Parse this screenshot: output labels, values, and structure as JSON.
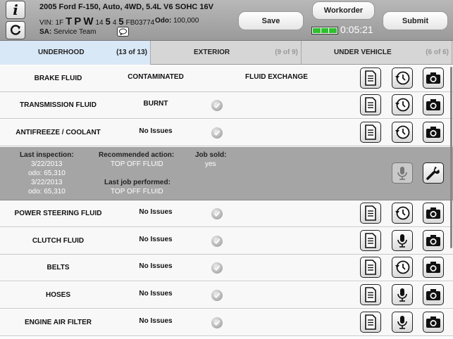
{
  "header": {
    "vehicle_title": "2005 Ford F-150, Auto, 4WD, 5.4L V6 SOHC 16V",
    "vin_label": "VIN:",
    "vin_parts": [
      "1F",
      "T",
      "P",
      "W",
      "14",
      "5",
      "4",
      "5",
      "FB03774"
    ],
    "odo_label": "Odo:",
    "odo_value": "100,000",
    "sa_label": "SA:",
    "sa_value": "Service Team",
    "save_label": "Save",
    "workorder_label": "Workorder",
    "submit_label": "Submit",
    "timer": "0:05:21",
    "progress_segments_filled": 3
  },
  "tabs": [
    {
      "label": "UNDERHOOD",
      "count": "(13 of 13)",
      "active": true
    },
    {
      "label": "EXTERIOR",
      "count": "(9 of 9)",
      "active": false
    },
    {
      "label": "UNDER VEHICLE",
      "count": "(6 of 6)",
      "active": false
    }
  ],
  "rows": [
    {
      "name": "BRAKE FLUID",
      "condition": "CONTAMINATED",
      "recommendation": "FLUID EXCHANGE",
      "check": false,
      "icons": [
        "notes",
        "history",
        "camera"
      ]
    },
    {
      "name": "TRANSMISSION FLUID",
      "condition": "BURNT",
      "recommendation": "",
      "check": true,
      "icons": [
        "notes",
        "history",
        "camera"
      ]
    },
    {
      "name": "ANTIFREEZE / COOLANT",
      "condition": "No Issues",
      "recommendation": "",
      "check": true,
      "icons": [
        "notes",
        "history",
        "camera"
      ]
    },
    {
      "name": "POWER STEERING FLUID",
      "condition": "No Issues",
      "recommendation": "",
      "check": true,
      "icons": [
        "notes",
        "history",
        "camera"
      ]
    },
    {
      "name": "CLUTCH FLUID",
      "condition": "No Issues",
      "recommendation": "",
      "check": true,
      "icons": [
        "notes",
        "microphone",
        "camera"
      ]
    },
    {
      "name": "BELTS",
      "condition": "No Issues",
      "recommendation": "",
      "check": true,
      "icons": [
        "notes",
        "history",
        "camera"
      ]
    },
    {
      "name": "HOSES",
      "condition": "No Issues",
      "recommendation": "",
      "check": true,
      "icons": [
        "notes",
        "microphone",
        "camera"
      ]
    },
    {
      "name": "ENGINE AIR FILTER",
      "condition": "No Issues",
      "recommendation": "",
      "check": true,
      "icons": [
        "notes",
        "microphone",
        "camera"
      ]
    }
  ],
  "details": {
    "last_inspection_label": "Last inspection:",
    "inspection_1_date": "3/22/2013",
    "inspection_1_odo": "odo: 65,310",
    "inspection_2_date": "3/22/2013",
    "inspection_2_odo": "odo: 65,310",
    "recommended_label": "Recommended action:",
    "recommended_value": "TOP OFF FLUID",
    "job_sold_label": "Job sold:",
    "job_sold_value": "yes",
    "last_job_label": "Last job performed:",
    "last_job_value": "TOP OFF FLUID"
  },
  "colors": {
    "active_tab": "#d9e8f7",
    "progress_green": "#2fbe2f",
    "details_bg": "#a5a5a5"
  }
}
